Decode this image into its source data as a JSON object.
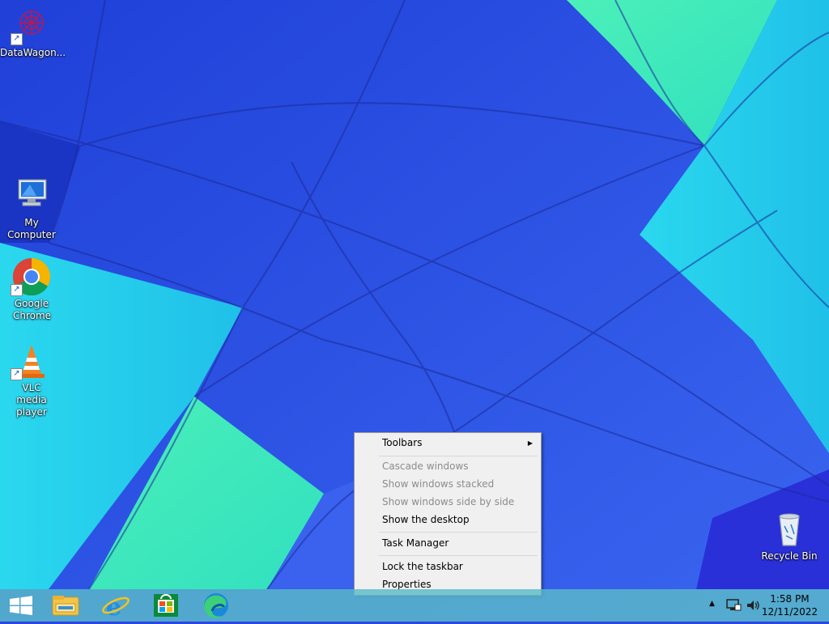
{
  "desktop": {
    "icons": [
      {
        "label": "DataWagon...",
        "icon": "datawagon-icon"
      },
      {
        "label": "My Computer",
        "icon": "computer-icon"
      },
      {
        "label": "Google Chrome",
        "icon": "chrome-icon"
      },
      {
        "label": "VLC media player",
        "icon": "vlc-icon"
      },
      {
        "label": "Recycle Bin",
        "icon": "recycle-bin-icon"
      }
    ]
  },
  "context_menu": {
    "toolbars": "Toolbars",
    "cascade": "Cascade windows",
    "stacked": "Show windows stacked",
    "side_by_side": "Show windows side by side",
    "show_desktop": "Show the desktop",
    "task_manager": "Task Manager",
    "lock_taskbar": "Lock the taskbar",
    "properties": "Properties"
  },
  "taskbar": {
    "pinned": [
      "start-icon",
      "file-explorer-icon",
      "internet-explorer-icon",
      "store-icon",
      "edge-icon"
    ],
    "tray_icons": [
      "chevron-up-icon",
      "network-icon",
      "volume-icon"
    ],
    "clock": {
      "time": "1:58 PM",
      "date": "12/11/2022"
    }
  },
  "colors": {
    "menu_bg": "#f0f0f0",
    "taskbar_bg": "#5ab9c8",
    "disabled_text": "#8c8c8c"
  }
}
